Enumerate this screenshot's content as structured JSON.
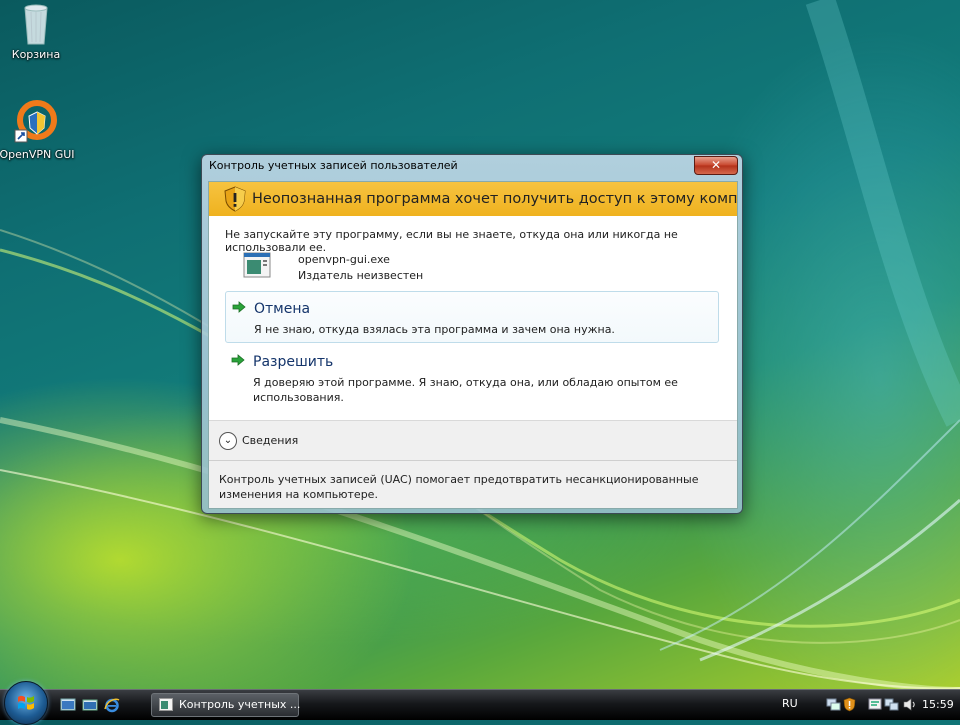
{
  "desktop": {
    "icons": [
      {
        "label": "Корзина",
        "icon": "recycle-bin-icon"
      },
      {
        "label": "OpenVPN GUI",
        "icon": "openvpn-icon"
      }
    ]
  },
  "dialog": {
    "title": "Контроль учетных записей пользователей",
    "close_label": "✕",
    "banner": "Неопознанная программа хочет получить доступ к этому компьютеру",
    "warning": "Не запускайте эту программу, если вы не знаете, откуда она или никогда не использовали ее.",
    "program": {
      "name": "openvpn-gui.exe",
      "publisher": "Издатель неизвестен"
    },
    "options": [
      {
        "label": "Отмена",
        "description": "Я не знаю, откуда взялась эта программа и зачем она нужна."
      },
      {
        "label": "Разрешить",
        "description": "Я доверяю этой программе. Я знаю, откуда она, или обладаю опытом ее использования."
      }
    ],
    "details_label": "Сведения",
    "footer": "Контроль учетных записей (UAC) помогает предотвратить несанкционированные изменения на компьютере.",
    "colors": {
      "banner": "#f3bb2e",
      "accent": "#15356b"
    }
  },
  "taskbar": {
    "task_button": "Контроль учетных ...",
    "language": "RU",
    "clock": "15:59"
  }
}
